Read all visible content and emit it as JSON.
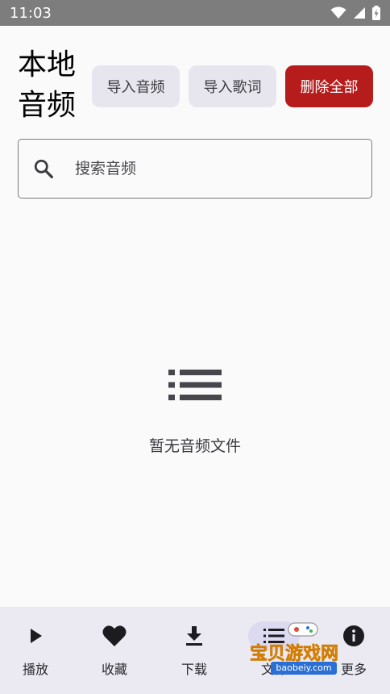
{
  "status_bar": {
    "time": "11:03",
    "icons": [
      "wifi-icon",
      "signal-icon",
      "battery-charging-icon"
    ]
  },
  "header": {
    "title": "本地音频",
    "buttons": {
      "import_audio": "导入音频",
      "import_lyrics": "导入歌词",
      "delete_all": "删除全部"
    },
    "colors": {
      "secondary_button_bg": "#e7e6ee",
      "danger_button_bg": "#b71c1c"
    }
  },
  "search": {
    "placeholder": "搜索音频",
    "value": ""
  },
  "empty_state": {
    "icon": "list-icon",
    "message": "暂无音频文件"
  },
  "bottom_nav": {
    "items": [
      {
        "icon": "play-icon",
        "label": "播放"
      },
      {
        "icon": "heart-icon",
        "label": "收藏"
      },
      {
        "icon": "download-icon",
        "label": "下载"
      },
      {
        "icon": "list-icon",
        "label": "文件",
        "active": true
      },
      {
        "icon": "info-icon",
        "label": "更多"
      }
    ]
  },
  "watermark": {
    "title": "宝贝游戏网",
    "url": "baobeiy.com"
  }
}
